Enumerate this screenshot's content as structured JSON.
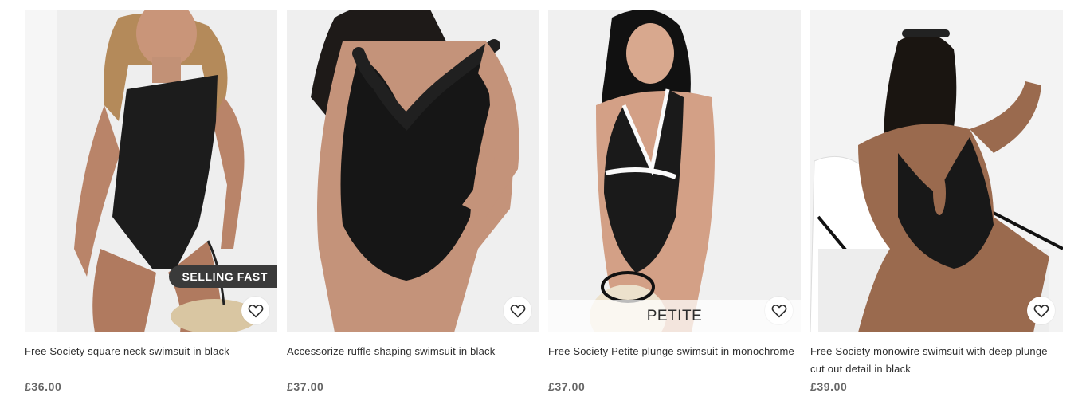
{
  "products": [
    {
      "title": "Free Society square neck swimsuit in black",
      "price": "£36.00",
      "badge": "SELLING FAST",
      "wishlist_icon": "heart-outline-icon"
    },
    {
      "title": "Accessorize ruffle shaping swimsuit in black",
      "price": "£37.00",
      "wishlist_icon": "heart-outline-icon"
    },
    {
      "title": "Free Society Petite plunge swimsuit in monochrome",
      "price": "£37.00",
      "band": "PETITE",
      "wishlist_icon": "heart-outline-icon"
    },
    {
      "title": "Free Society monowire swimsuit with deep plunge cut out detail in black",
      "price": "£39.00",
      "wishlist_icon": "heart-outline-icon"
    }
  ],
  "colors": {
    "badge_bg": "#3a3a3a",
    "price_text": "#666666",
    "title_text": "#2d2d2d",
    "image_bg": "#f1f1f1"
  }
}
